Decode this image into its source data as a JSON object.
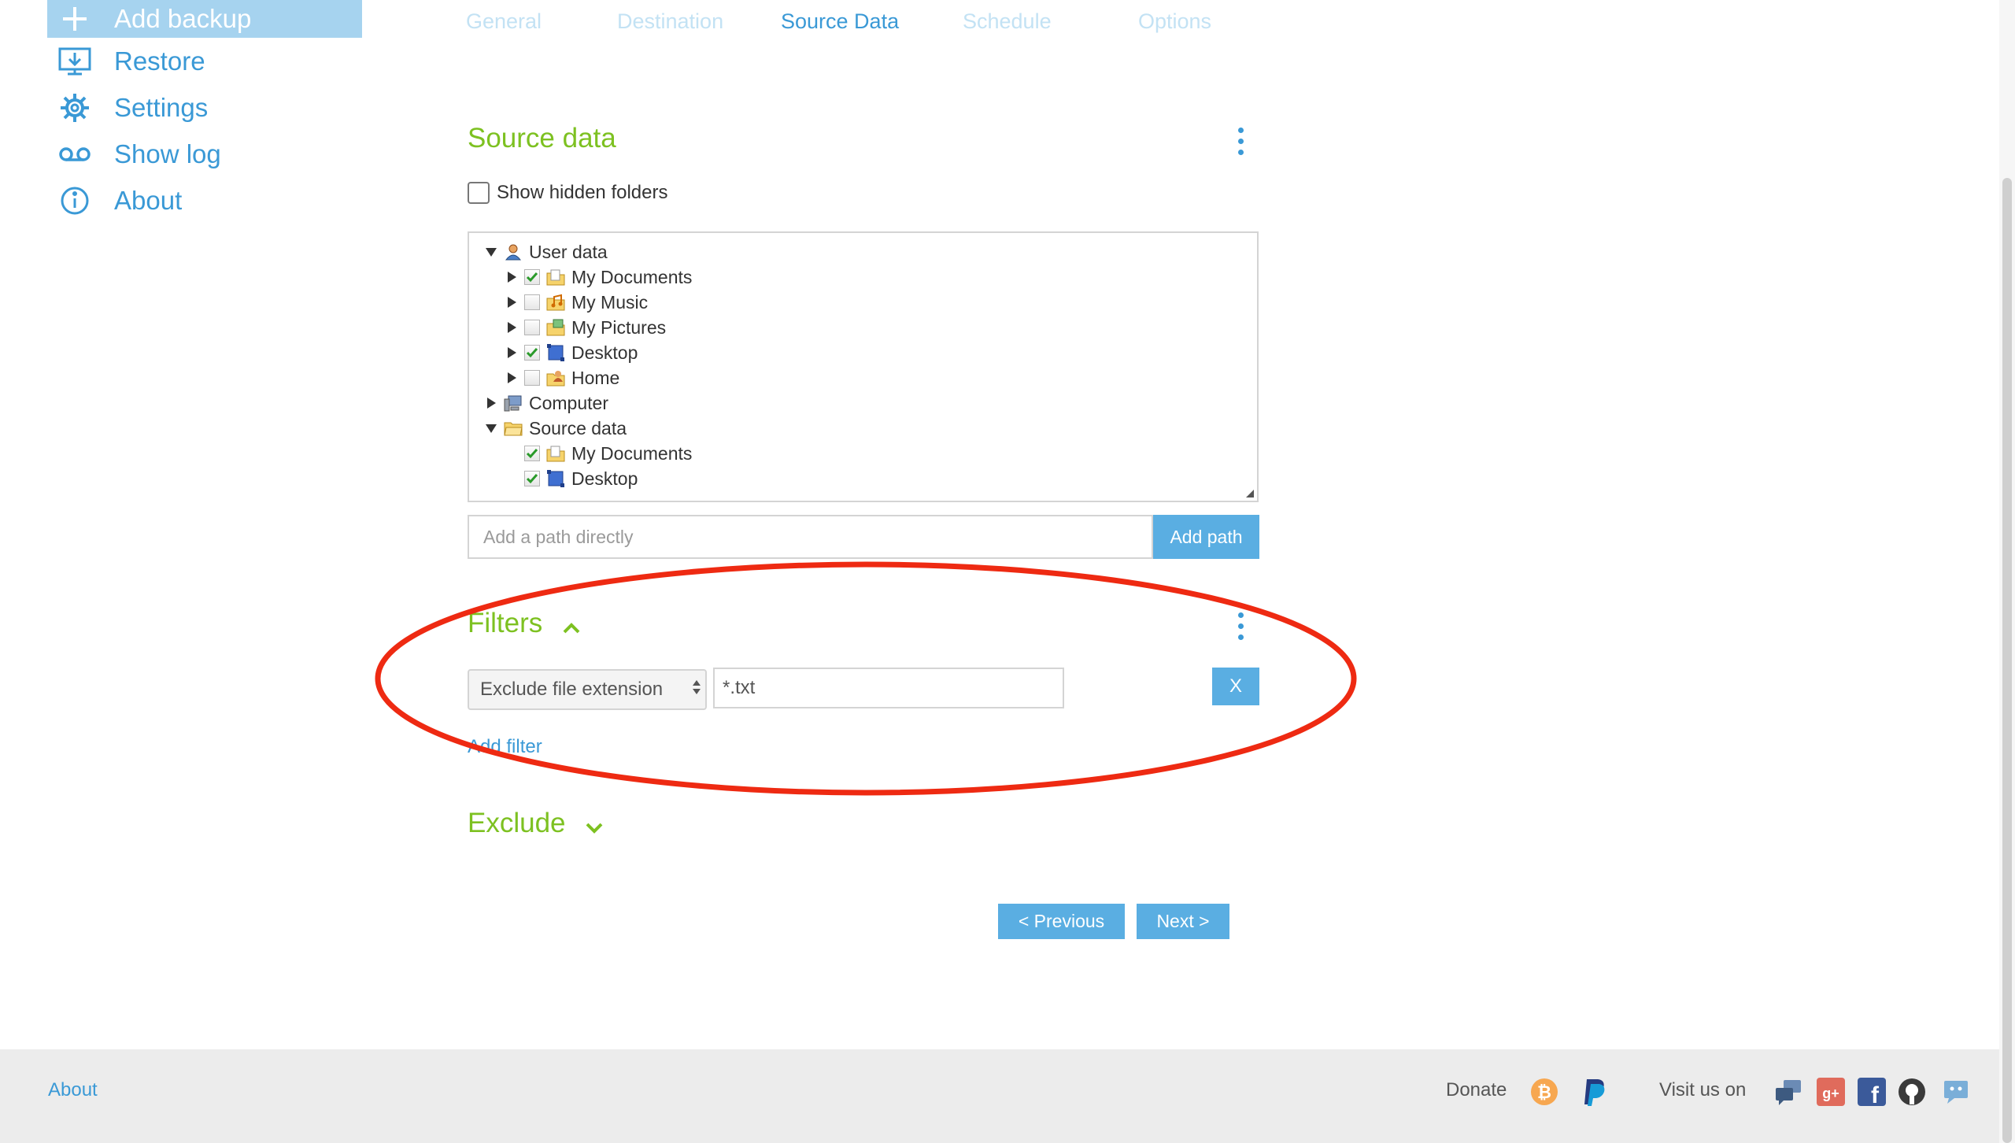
{
  "sidebar": {
    "items": [
      {
        "label": "Add backup",
        "icon": "plus-icon",
        "active": true
      },
      {
        "label": "Restore",
        "icon": "restore-icon"
      },
      {
        "label": "Settings",
        "icon": "gear-icon"
      },
      {
        "label": "Show log",
        "icon": "voicemail-icon"
      },
      {
        "label": "About",
        "icon": "info-icon"
      }
    ]
  },
  "tabs": [
    {
      "label": "General"
    },
    {
      "label": "Destination"
    },
    {
      "label": "Source Data",
      "active": true
    },
    {
      "label": "Schedule"
    },
    {
      "label": "Options"
    }
  ],
  "source": {
    "title": "Source data",
    "show_hidden_label": "Show hidden folders",
    "tree": [
      {
        "label": "User data",
        "level": 0,
        "expanded": true,
        "icon": "user-icon"
      },
      {
        "label": "My Documents",
        "level": 1,
        "checked": true,
        "icon": "documents-folder-icon"
      },
      {
        "label": "My Music",
        "level": 1,
        "checked": false,
        "icon": "music-folder-icon"
      },
      {
        "label": "My Pictures",
        "level": 1,
        "checked": false,
        "icon": "pictures-folder-icon"
      },
      {
        "label": "Desktop",
        "level": 1,
        "checked": true,
        "icon": "desktop-icon"
      },
      {
        "label": "Home",
        "level": 1,
        "checked": false,
        "icon": "home-folder-icon"
      },
      {
        "label": "Computer",
        "level": 0,
        "expanded": false,
        "icon": "computer-icon"
      },
      {
        "label": "Source data",
        "level": 0,
        "expanded": true,
        "icon": "folder-icon"
      },
      {
        "label": "My Documents",
        "level": 1,
        "checked": true,
        "leaf": true,
        "icon": "documents-folder-icon"
      },
      {
        "label": "Desktop",
        "level": 1,
        "checked": true,
        "leaf": true,
        "icon": "desktop-icon"
      }
    ],
    "path_placeholder": "Add a path directly",
    "add_path_label": "Add path"
  },
  "filters": {
    "title": "Filters",
    "type_value": "Exclude file extension",
    "pattern_value": "*.txt",
    "remove_label": "X",
    "add_filter_label": "Add filter"
  },
  "exclude": {
    "title": "Exclude"
  },
  "nav": {
    "previous_label": "< Previous",
    "next_label": "Next >"
  },
  "footer": {
    "about_label": "About",
    "donate_label": "Donate",
    "visit_label": "Visit us on",
    "donate_icons": [
      "bitcoin-icon",
      "paypal-icon"
    ],
    "social_icons": [
      "forum-icon",
      "google-plus-icon",
      "facebook-icon",
      "github-icon",
      "feedback-icon"
    ]
  },
  "colors": {
    "accent": "#3a99d6",
    "section_title": "#7dc121",
    "active_nav": "#a6d3ef",
    "button": "#5aaee2",
    "annotation": "#ee2a12"
  }
}
